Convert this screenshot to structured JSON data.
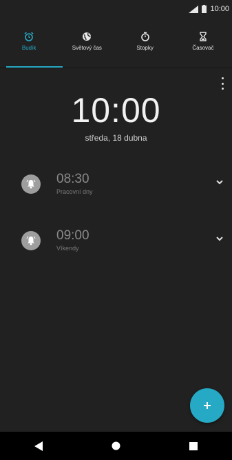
{
  "status_bar": {
    "time": "10:00"
  },
  "tabs": [
    {
      "label": "Budík",
      "icon": "alarm-clock-icon",
      "active": true
    },
    {
      "label": "Světový čas",
      "icon": "globe-icon",
      "active": false
    },
    {
      "label": "Stopky",
      "icon": "stopwatch-icon",
      "active": false
    },
    {
      "label": "Časovač",
      "icon": "hourglass-icon",
      "active": false
    }
  ],
  "clock": {
    "time": "10:00",
    "date": "středa, 18 dubna"
  },
  "alarms": [
    {
      "time": "08:30",
      "days": "Pracovní dny"
    },
    {
      "time": "09:00",
      "days": "Víkendy"
    }
  ],
  "colors": {
    "accent": "#26a9c4",
    "background": "#212121"
  }
}
